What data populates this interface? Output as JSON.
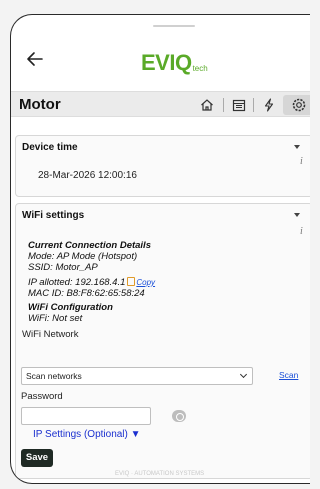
{
  "header": {
    "logo_main": "EVIQ",
    "logo_sub": "tech"
  },
  "title_bar": {
    "title": "Motor",
    "icons": [
      "home-icon",
      "calendar-icon",
      "bolt-icon",
      "gear-icon"
    ]
  },
  "device_time": {
    "title": "Device time",
    "value": "28-Mar-2026 12:00:16",
    "info": "i"
  },
  "wifi": {
    "title": "WiFi settings",
    "info": "i",
    "current_heading": "Current Connection Details",
    "mode": "Mode: AP Mode (Hotspot)",
    "ssid": "SSID: Motor_AP",
    "ip": "IP allotted: 192.168.4.1",
    "copy_label": "Copy",
    "mac": "MAC ID: B8:F8:62:65:58:24",
    "config_heading": "WiFi Configuration",
    "wifi_status": "WiFi: Not set",
    "network_label": "WiFi Network",
    "network_selected": "Scan networks",
    "scan_label": "Scan",
    "password_label": "Password",
    "password_value": "",
    "ip_settings_label": "IP Settings (Optional) ▼",
    "save_label": "Save"
  },
  "footer": {
    "text": "EVIQ · AUTOMATION SYSTEMS"
  },
  "colors": {
    "brand_green": "#5aaa28",
    "link_blue": "#1a4fd8",
    "save_bg": "#1f2a24"
  }
}
